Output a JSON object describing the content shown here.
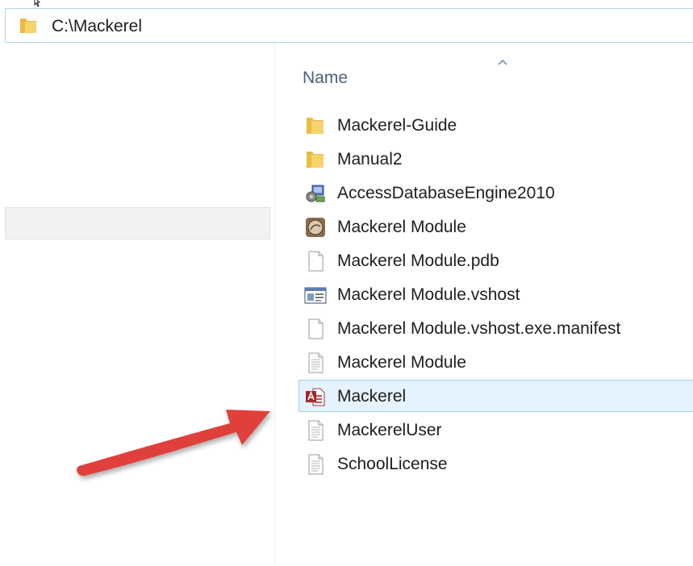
{
  "address_bar": {
    "path": "C:\\Mackerel",
    "icon": "folder-icon"
  },
  "file_list": {
    "column_header": "Name",
    "sort": "ascending",
    "items": [
      {
        "name": "Mackerel-Guide",
        "icon": "folder-icon"
      },
      {
        "name": "Manual2",
        "icon": "folder-icon"
      },
      {
        "name": "AccessDatabaseEngine2010",
        "icon": "installer-icon"
      },
      {
        "name": "Mackerel Module",
        "icon": "application-icon"
      },
      {
        "name": "Mackerel Module.pdb",
        "icon": "blank-file-icon"
      },
      {
        "name": "Mackerel Module.vshost",
        "icon": "window-app-icon"
      },
      {
        "name": "Mackerel Module.vshost.exe.manifest",
        "icon": "blank-file-icon"
      },
      {
        "name": "Mackerel Module",
        "icon": "text-file-icon"
      },
      {
        "name": "Mackerel",
        "icon": "access-database-icon",
        "selected": true
      },
      {
        "name": "MackerelUser",
        "icon": "text-file-icon"
      },
      {
        "name": "SchoolLicense",
        "icon": "text-file-icon"
      }
    ]
  },
  "colors": {
    "selection_fill": "#e5f3ff",
    "selection_border": "#99d1ff",
    "annotation_arrow": "#e0413a",
    "header_text": "#4c607a"
  }
}
